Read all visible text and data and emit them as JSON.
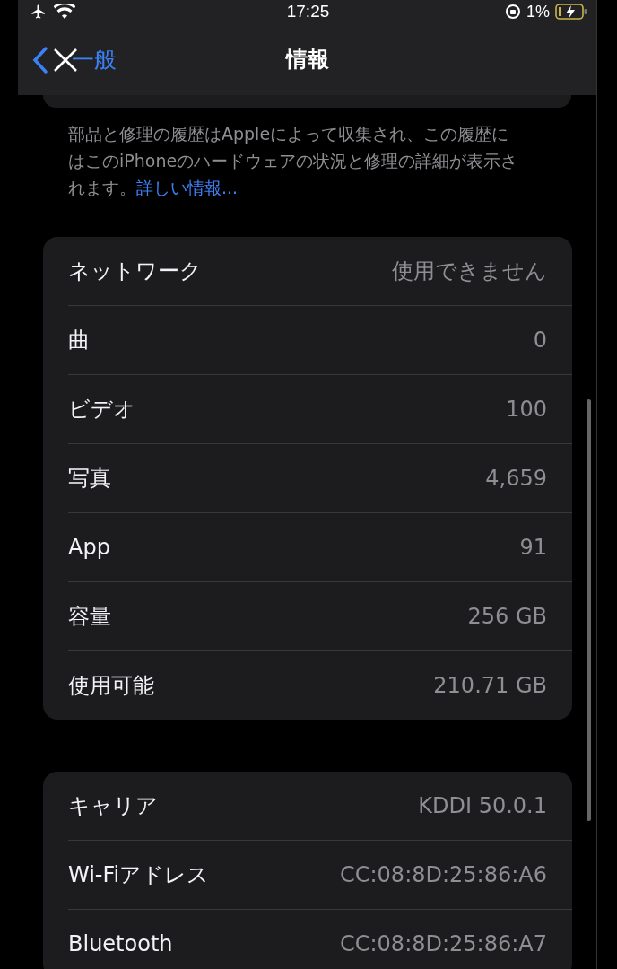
{
  "status_bar": {
    "time": "17:25",
    "battery_percent": "1%"
  },
  "nav_bar": {
    "back_label": "一般",
    "title": "情報"
  },
  "footer": {
    "text": "部品と修理の履歴はAppleによって収集され、この履歴にはこのiPhoneのハードウェアの状況と修理の詳細が表示されます。",
    "link": "詳しい情報..."
  },
  "sections": [
    {
      "rows": [
        {
          "label": "ネットワーク",
          "value": "使用できません"
        },
        {
          "label": "曲",
          "value": "0"
        },
        {
          "label": "ビデオ",
          "value": "100"
        },
        {
          "label": "写真",
          "value": "4,659"
        },
        {
          "label": "App",
          "value": "91"
        },
        {
          "label": "容量",
          "value": "256 GB"
        },
        {
          "label": "使用可能",
          "value": "210.71 GB"
        }
      ]
    },
    {
      "rows": [
        {
          "label": "キャリア",
          "value": "KDDI 50.0.1"
        },
        {
          "label": "Wi-Fiアドレス",
          "value": "CC:08:8D:25:86:A6"
        },
        {
          "label": "Bluetooth",
          "value": "CC:08:8D:25:86:A7"
        }
      ]
    }
  ]
}
